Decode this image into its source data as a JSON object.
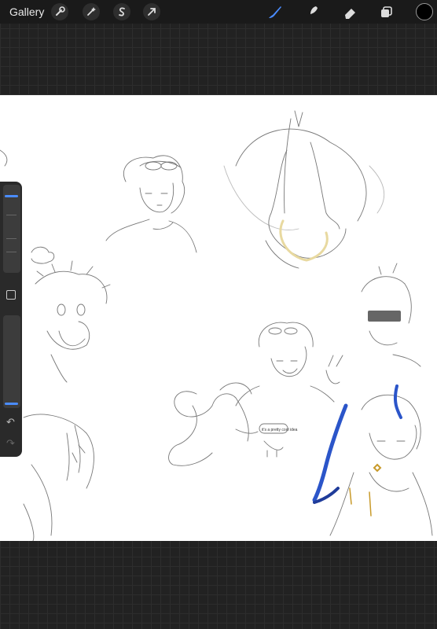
{
  "toolbar": {
    "gallery_label": "Gallery",
    "left_tools": [
      {
        "name": "adjustments",
        "icon": "wrench-icon"
      },
      {
        "name": "adjust",
        "icon": "magic-wand-icon"
      },
      {
        "name": "selection",
        "icon": "selection-s-icon"
      },
      {
        "name": "transform",
        "icon": "cursor-arrow-icon"
      }
    ],
    "right_tools": [
      {
        "name": "brush",
        "icon": "brush-icon",
        "active": true
      },
      {
        "name": "smudge",
        "icon": "smudge-icon",
        "active": false
      },
      {
        "name": "eraser",
        "icon": "eraser-icon",
        "active": false
      },
      {
        "name": "layers",
        "icon": "layers-icon",
        "active": false
      }
    ],
    "current_color": "#000000",
    "active_color": "#4a8cff"
  },
  "sidebar": {
    "size_slider_level": 0.88,
    "opacity_slider_level": 0.06,
    "modify_icon": "square-icon",
    "undo_icon": "undo-arrow-icon",
    "redo_icon": "redo-arrow-icon"
  },
  "canvas": {
    "sketch_note": "it's a pretty cool idea"
  }
}
